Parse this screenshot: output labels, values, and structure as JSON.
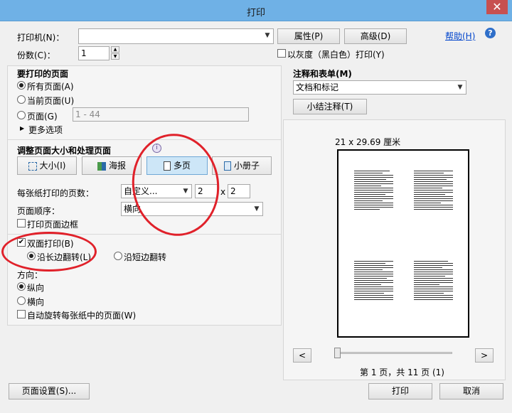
{
  "window": {
    "title": "打印",
    "close": "✕"
  },
  "printer": {
    "label": "打印机(N)：",
    "value": "",
    "properties": "属性(P)",
    "advanced": "高级(D)",
    "help": "帮助(H)"
  },
  "copies": {
    "label": "份数(C)：",
    "value": "1",
    "grayscale_label": "以灰度（黑白色）打印(Y)",
    "grayscale_checked": false
  },
  "pages_to_print": {
    "title": "要打印的页面",
    "all": "所有页面(A)",
    "current": "当前页面(U)",
    "pages": "页面(G)",
    "range_placeholder": "1 - 44",
    "more_options": "更多选项"
  },
  "sizing": {
    "title": "调整页面大小和处理页面",
    "info_icon": "i",
    "tabs": [
      "大小(I)",
      "海报",
      "多页",
      "小册子"
    ],
    "selected_tab": "多页",
    "pages_per_sheet_label": "每张纸打印的页数：",
    "pages_per_sheet_value": "自定义...",
    "cols": "2",
    "x": "x",
    "rows": "2",
    "page_order_label": "页面顺序：",
    "page_order_value": "横向",
    "print_border": "打印页面边框"
  },
  "duplex": {
    "label": "双面打印(B)",
    "checked": true,
    "long_edge": "沿长边翻转(L)",
    "short_edge": "沿短边翻转"
  },
  "orientation": {
    "title": "方向：",
    "portrait": "纵向",
    "landscape": "横向",
    "auto_rotate": "自动旋转每张纸中的页面(W)"
  },
  "comments": {
    "title": "注释和表单(M)",
    "value": "文档和标记",
    "summarize": "小结注释(T)"
  },
  "preview": {
    "size": "21 x 29.69 厘米",
    "prev": "<",
    "next": ">",
    "status": "第 1 页，共 11 页 (1)"
  },
  "footer": {
    "page_setup": "页面设置(S)...",
    "print": "打印",
    "cancel": "取消"
  },
  "colors": {
    "annotation": "#e0212a",
    "titlebar": "#6fb1e6",
    "selected_tab": "#cde6f7"
  }
}
